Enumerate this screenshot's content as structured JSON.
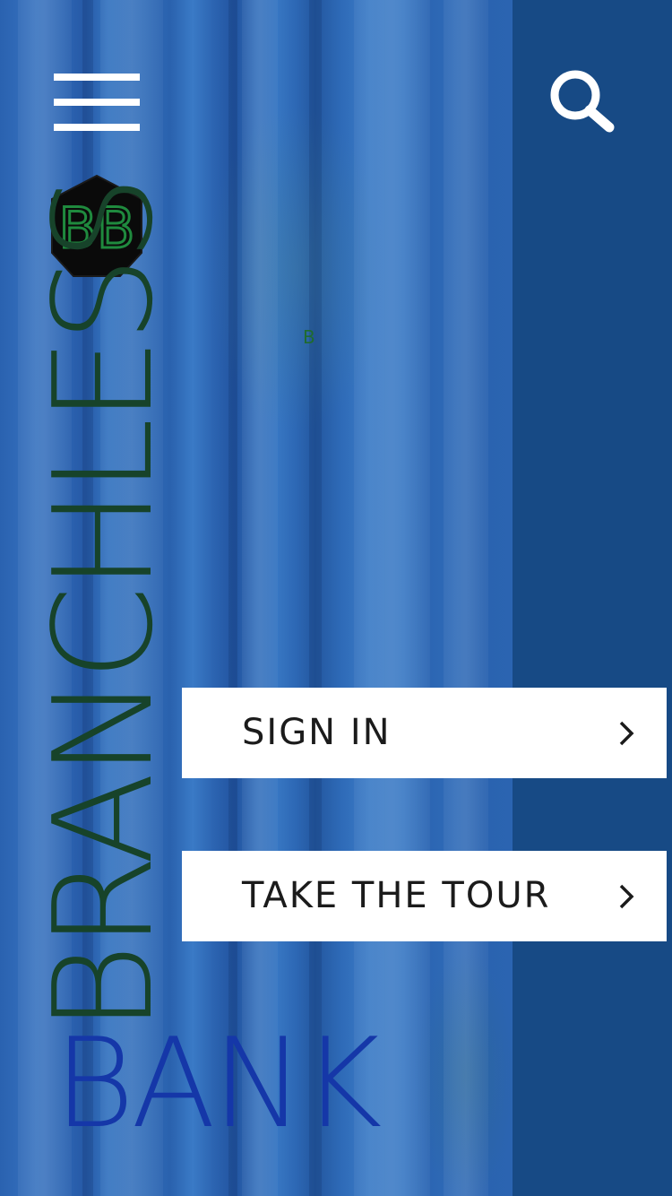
{
  "header": {
    "menu_icon": "hamburger-menu-icon",
    "search_icon": "search-icon"
  },
  "logo": {
    "letters": "BB",
    "colors": {
      "hexagon": "#0a0a0a",
      "letters": "#1f8a3e"
    }
  },
  "background": {
    "stray_letter": "B"
  },
  "brand": {
    "word_vertical": "BRANCHLESS",
    "word_horizontal": "BANK",
    "colors": {
      "vertical": "#17432a",
      "horizontal": "#1537a8"
    }
  },
  "actions": {
    "sign_in_label": "SIGN IN",
    "tour_label": "TAKE THE TOUR",
    "chevron_icon": "chevron-right-icon"
  },
  "colors": {
    "panel_blue": "#174a85",
    "button_bg": "#ffffff",
    "button_text": "#1b1b1b"
  }
}
